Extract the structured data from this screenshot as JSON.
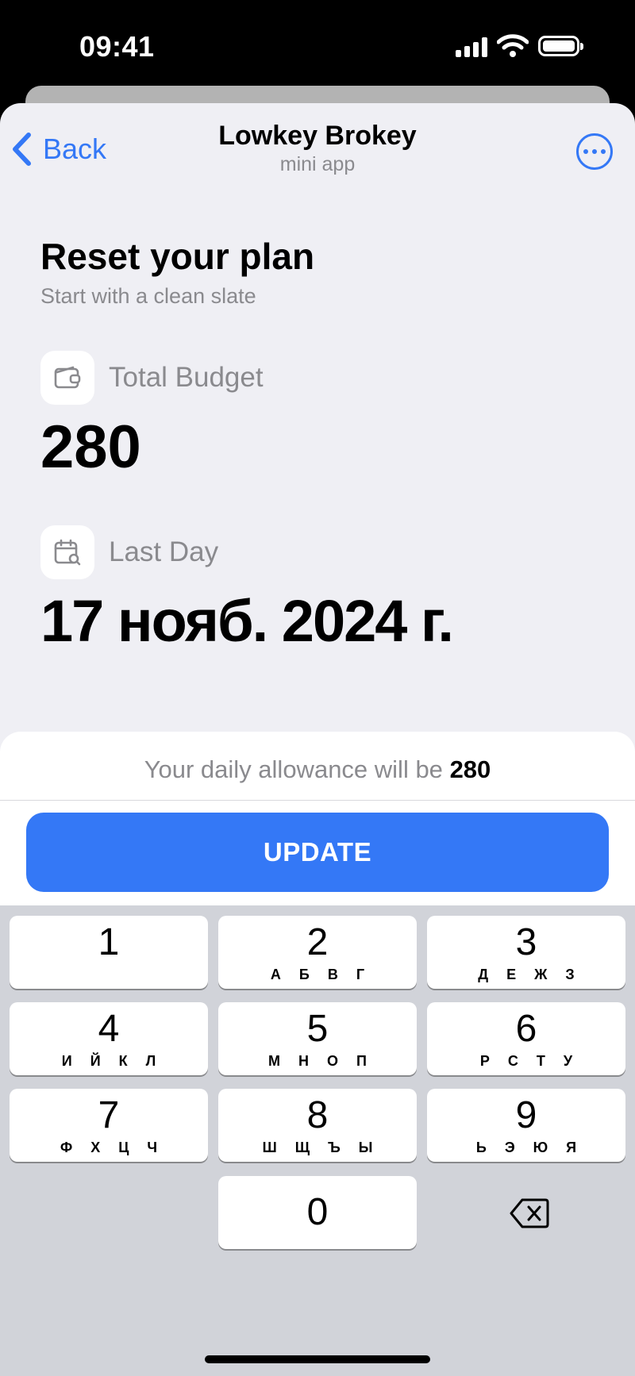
{
  "status_bar": {
    "time": "09:41"
  },
  "nav": {
    "back_label": "Back",
    "title": "Lowkey Brokey",
    "subtitle": "mini app"
  },
  "header": {
    "title": "Reset your plan",
    "subtitle": "Start with a clean slate"
  },
  "budget": {
    "label": "Total Budget",
    "value": "280",
    "icon": "wallet-icon"
  },
  "last_day": {
    "label": "Last Day",
    "value": "17 нояб. 2024 г.",
    "icon": "calendar-search-icon"
  },
  "summary": {
    "prefix": "Your daily allowance will be",
    "amount": "280"
  },
  "update_button": {
    "label": "UPDATE"
  },
  "colors": {
    "accent": "#3478f6",
    "sheet_bg": "#efeff4",
    "keyboard_bg": "#d1d3d9"
  },
  "keypad": [
    {
      "digit": "1",
      "letters": ""
    },
    {
      "digit": "2",
      "letters": "А Б В Г"
    },
    {
      "digit": "3",
      "letters": "Д Е Ж З"
    },
    {
      "digit": "4",
      "letters": "И Й К Л"
    },
    {
      "digit": "5",
      "letters": "М Н О П"
    },
    {
      "digit": "6",
      "letters": "Р С Т У"
    },
    {
      "digit": "7",
      "letters": "Ф Х Ц Ч"
    },
    {
      "digit": "8",
      "letters": "Ш Щ Ъ Ы"
    },
    {
      "digit": "9",
      "letters": "Ь Э Ю Я"
    },
    {
      "digit": "0",
      "letters": ""
    }
  ]
}
